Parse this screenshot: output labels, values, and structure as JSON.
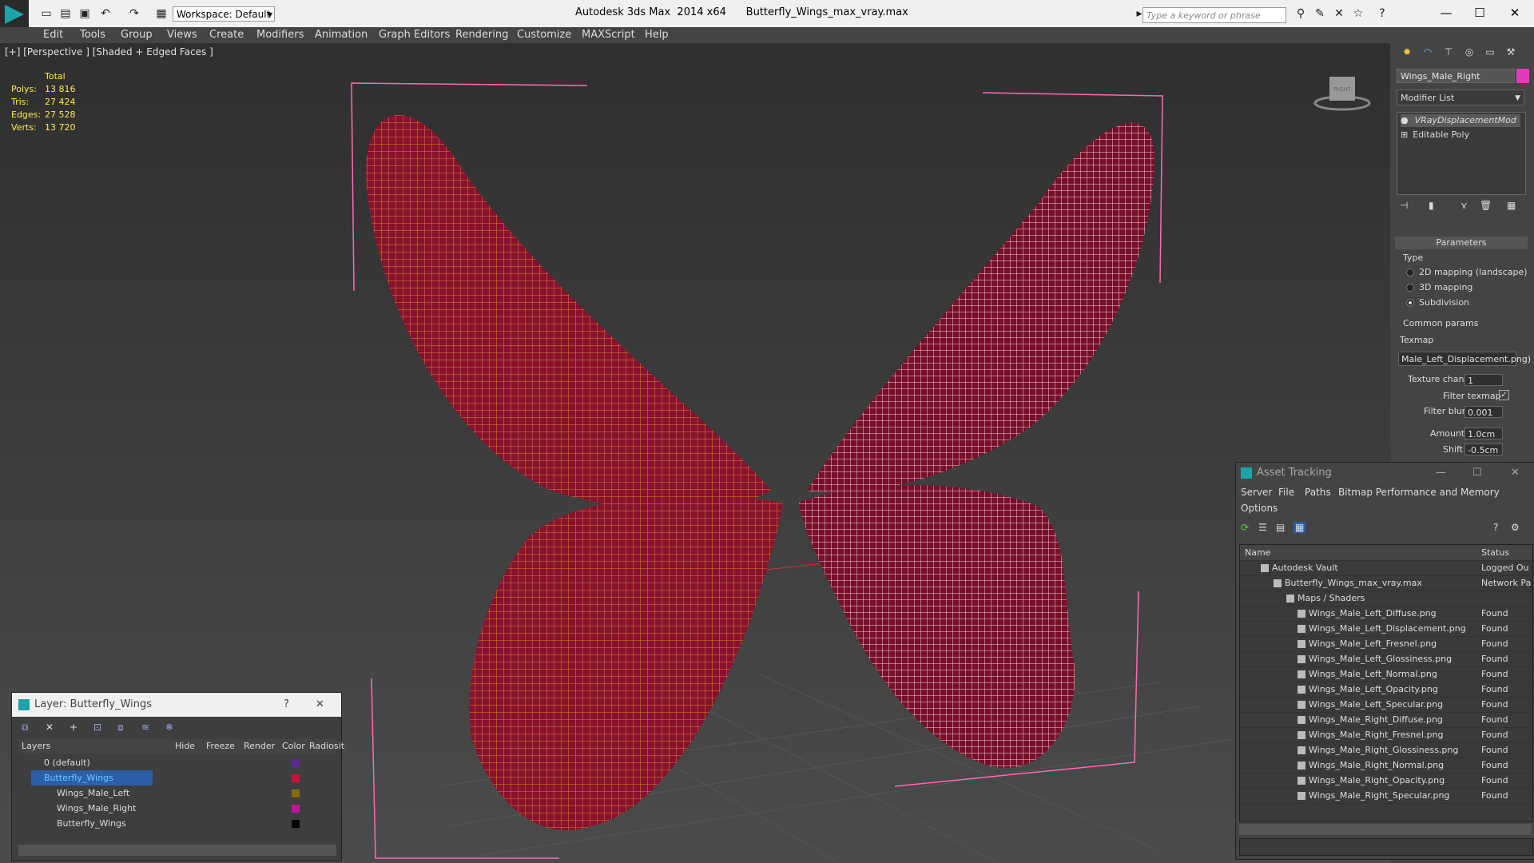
{
  "titlebar": {
    "workspace": "Workspace: Default",
    "title": "Autodesk 3ds Max  2014 x64      Butterfly_Wings_max_vray.max",
    "search_placeholder": "Type a keyword or phrase"
  },
  "menu": [
    "Edit",
    "Tools",
    "Group",
    "Views",
    "Create",
    "Modifiers",
    "Animation",
    "Graph Editors",
    "Rendering",
    "Customize",
    "MAXScript",
    "Help"
  ],
  "viewport": {
    "label": "[+] [Perspective ] [Shaded + Edged Faces ]",
    "stats_header": "Total",
    "stats": [
      {
        "label": "Polys:",
        "value": "13 816"
      },
      {
        "label": "Tris:",
        "value": "27 424"
      },
      {
        "label": "Edges:",
        "value": "27 528"
      },
      {
        "label": "Verts:",
        "value": "13 720"
      }
    ],
    "viewcube_label": "RIGHT"
  },
  "command_panel": {
    "object_name": "Wings_Male_Right",
    "modifier_list": "Modifier List",
    "stack": [
      "VRayDisplacementMod",
      "Editable Poly"
    ],
    "parameters_title": "Parameters",
    "type_label": "Type",
    "type_options": [
      "2D mapping (landscape)",
      "3D mapping",
      "Subdivision"
    ],
    "common_params": "Common params",
    "texmap_label": "Texmap",
    "texmap_value": "Male_Left_Displacement.png)",
    "texture_chan_label": "Texture chan",
    "texture_chan_value": "1",
    "filter_texmap": "Filter texmap",
    "filter_blur_label": "Filter blur",
    "filter_blur_value": "0.001",
    "amount_label": "Amount",
    "amount_value": "1.0cm",
    "shift_label": "Shift",
    "shift_value": "-0.5cm",
    "colors": {
      "object": "#e03cb8"
    }
  },
  "layer_dialog": {
    "title": "Layer: Butterfly_Wings",
    "help": "?",
    "columns": [
      "Layers",
      "Hide",
      "Freeze",
      "Render",
      "Color",
      "Radiosit"
    ],
    "rows": [
      {
        "name": "0 (default)",
        "color": "#5a2a9a"
      },
      {
        "name": "Butterfly_Wings",
        "color": "#c8143c"
      },
      {
        "name": "Wings_Male_Left",
        "color": "#8a6a10"
      },
      {
        "name": "Wings_Male_Right",
        "color": "#c0149a"
      },
      {
        "name": "Butterfly_Wings",
        "color": "#000000"
      }
    ]
  },
  "asset_dialog": {
    "title": "Asset Tracking",
    "menu": [
      "Server",
      "File",
      "Paths",
      "Bitmap Performance and Memory",
      "Options"
    ],
    "columns": [
      "Name",
      "Status"
    ],
    "rows": [
      {
        "name": "Autodesk Vault",
        "status": "Logged Ou"
      },
      {
        "name": "Butterfly_Wings_max_vray.max",
        "status": "Network Pa"
      },
      {
        "name": "Maps / Shaders",
        "status": ""
      },
      {
        "name": "Wings_Male_Left_Diffuse.png",
        "status": "Found"
      },
      {
        "name": "Wings_Male_Left_Displacement.png",
        "status": "Found"
      },
      {
        "name": "Wings_Male_Left_Fresnel.png",
        "status": "Found"
      },
      {
        "name": "Wings_Male_Left_Glossiness.png",
        "status": "Found"
      },
      {
        "name": "Wings_Male_Left_Normal.png",
        "status": "Found"
      },
      {
        "name": "Wings_Male_Left_Opacity.png",
        "status": "Found"
      },
      {
        "name": "Wings_Male_Left_Specular.png",
        "status": "Found"
      },
      {
        "name": "Wings_Male_Right_Diffuse.png",
        "status": "Found"
      },
      {
        "name": "Wings_Male_Right_Fresnel.png",
        "status": "Found"
      },
      {
        "name": "Wings_Male_Right_Glossiness.png",
        "status": "Found"
      },
      {
        "name": "Wings_Male_Right_Normal.png",
        "status": "Found"
      },
      {
        "name": "Wings_Male_Right_Opacity.png",
        "status": "Found"
      },
      {
        "name": "Wings_Male_Right_Specular.png",
        "status": "Found"
      }
    ]
  }
}
